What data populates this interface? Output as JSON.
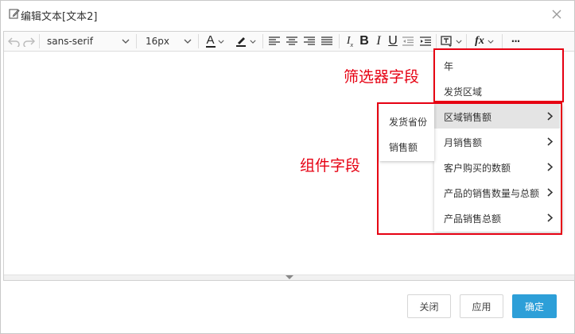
{
  "dialog": {
    "title": "编辑文本[文本2]"
  },
  "toolbar": {
    "font_family": "sans-serif",
    "font_size": "16px",
    "bold": "B",
    "italic": "I",
    "underline": "U",
    "text_color_glyph": "A",
    "fx_glyph": "fx",
    "more": "···"
  },
  "menus": {
    "filter_fields": [
      {
        "label": "年"
      },
      {
        "label": "发货区域"
      }
    ],
    "component_fields": [
      {
        "label": "区域销售额",
        "has_submenu": true,
        "highlighted": true
      },
      {
        "label": "月销售额",
        "has_submenu": true
      },
      {
        "label": "客户购买的数额",
        "has_submenu": true
      },
      {
        "label": "产品的销售数量与总额",
        "has_submenu": true
      },
      {
        "label": "产品销售总额",
        "has_submenu": true
      }
    ],
    "submenu": [
      {
        "label": "发货省份"
      },
      {
        "label": "销售额"
      }
    ]
  },
  "annotations": {
    "filter_fields": "筛选器字段",
    "component_fields": "组件字段"
  },
  "buttons": {
    "close": "关闭",
    "apply": "应用",
    "confirm": "确定"
  },
  "colors": {
    "annotation_red": "#e60012",
    "primary_button": "#2d9fd8",
    "menu_highlight": "#e4e4e4"
  }
}
